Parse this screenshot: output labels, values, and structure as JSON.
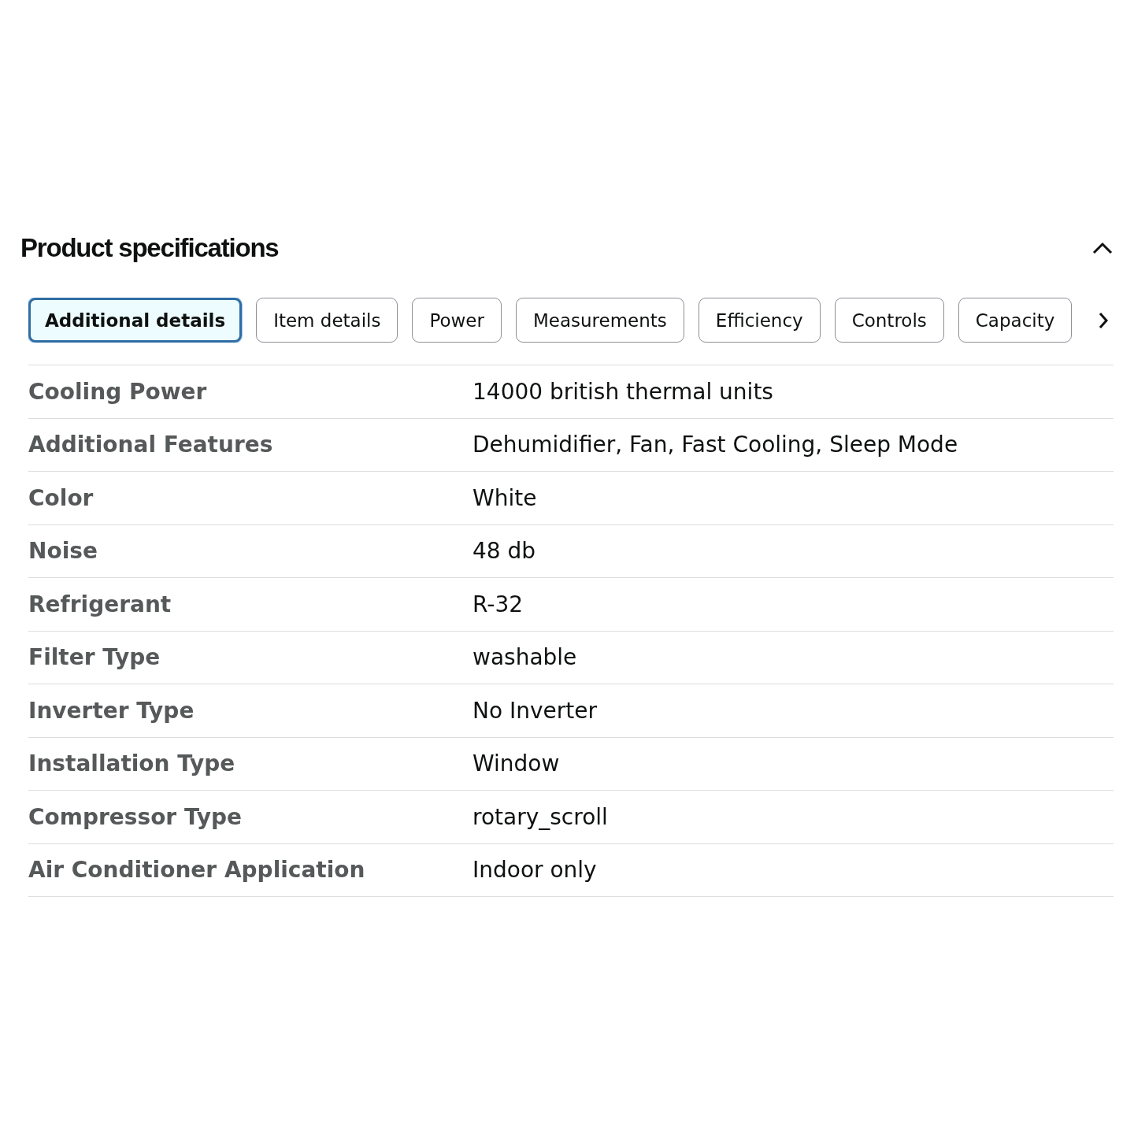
{
  "section": {
    "title": "Product specifications",
    "expanded": true
  },
  "tabs": [
    {
      "label": "Additional details",
      "selected": true
    },
    {
      "label": "Item details",
      "selected": false
    },
    {
      "label": "Power",
      "selected": false
    },
    {
      "label": "Measurements",
      "selected": false
    },
    {
      "label": "Efficiency",
      "selected": false
    },
    {
      "label": "Controls",
      "selected": false
    },
    {
      "label": "Capacity",
      "selected": false
    }
  ],
  "table": {
    "rows": [
      {
        "label": "Cooling Power",
        "value": "14000 british thermal units"
      },
      {
        "label": "Additional Features",
        "value": "Dehumidifier, Fan, Fast Cooling, Sleep Mode"
      },
      {
        "label": "Color",
        "value": "White"
      },
      {
        "label": "Noise",
        "value": "48 db"
      },
      {
        "label": "Refrigerant",
        "value": "R-32"
      },
      {
        "label": "Filter Type",
        "value": "washable"
      },
      {
        "label": "Inverter Type",
        "value": "No Inverter"
      },
      {
        "label": "Installation Type",
        "value": "Window"
      },
      {
        "label": "Compressor Type",
        "value": "rotary_scroll"
      },
      {
        "label": "Air Conditioner Application",
        "value": "Indoor only"
      }
    ]
  }
}
